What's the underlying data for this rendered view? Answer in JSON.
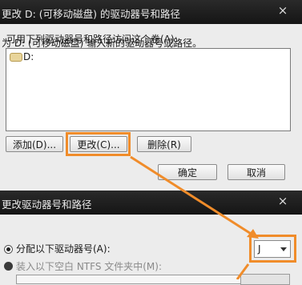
{
  "dialog1": {
    "title": "更改 D: (可移动磁盘) 的驱动器号和路径",
    "close_glyph": "×",
    "prompt": "可用下列驱动器号和路径访问这个卷(A):",
    "list_items": [
      {
        "icon": "drive-icon",
        "label": "D:"
      }
    ],
    "buttons": {
      "add": "添加(D)...",
      "change": "更改(C)...",
      "delete": "删除(R)",
      "ok": "确定",
      "cancel": "取消"
    }
  },
  "dialog2": {
    "title": "更改驱动器号和路径",
    "close_glyph": "×",
    "prompt": "为 D: (可移动磁盘) 输入新的驱动器号或路径。",
    "option_assign": "分配以下驱动器号(A):",
    "option_mount": "装入以下空白 NTFS 文件夹中(M):",
    "drive_letter": "J"
  },
  "colors": {
    "highlight": "#f08c2a",
    "titlebar": "#1f1f1f"
  }
}
